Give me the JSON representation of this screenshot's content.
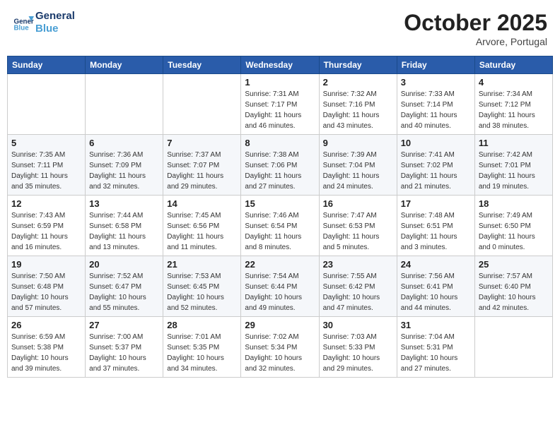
{
  "header": {
    "logo_line1": "General",
    "logo_line2": "Blue",
    "month_title": "October 2025",
    "location": "Arvore, Portugal"
  },
  "days_of_week": [
    "Sunday",
    "Monday",
    "Tuesday",
    "Wednesday",
    "Thursday",
    "Friday",
    "Saturday"
  ],
  "weeks": [
    [
      {
        "day": "",
        "info": ""
      },
      {
        "day": "",
        "info": ""
      },
      {
        "day": "",
        "info": ""
      },
      {
        "day": "1",
        "info": "Sunrise: 7:31 AM\nSunset: 7:17 PM\nDaylight: 11 hours\nand 46 minutes."
      },
      {
        "day": "2",
        "info": "Sunrise: 7:32 AM\nSunset: 7:16 PM\nDaylight: 11 hours\nand 43 minutes."
      },
      {
        "day": "3",
        "info": "Sunrise: 7:33 AM\nSunset: 7:14 PM\nDaylight: 11 hours\nand 40 minutes."
      },
      {
        "day": "4",
        "info": "Sunrise: 7:34 AM\nSunset: 7:12 PM\nDaylight: 11 hours\nand 38 minutes."
      }
    ],
    [
      {
        "day": "5",
        "info": "Sunrise: 7:35 AM\nSunset: 7:11 PM\nDaylight: 11 hours\nand 35 minutes."
      },
      {
        "day": "6",
        "info": "Sunrise: 7:36 AM\nSunset: 7:09 PM\nDaylight: 11 hours\nand 32 minutes."
      },
      {
        "day": "7",
        "info": "Sunrise: 7:37 AM\nSunset: 7:07 PM\nDaylight: 11 hours\nand 29 minutes."
      },
      {
        "day": "8",
        "info": "Sunrise: 7:38 AM\nSunset: 7:06 PM\nDaylight: 11 hours\nand 27 minutes."
      },
      {
        "day": "9",
        "info": "Sunrise: 7:39 AM\nSunset: 7:04 PM\nDaylight: 11 hours\nand 24 minutes."
      },
      {
        "day": "10",
        "info": "Sunrise: 7:41 AM\nSunset: 7:02 PM\nDaylight: 11 hours\nand 21 minutes."
      },
      {
        "day": "11",
        "info": "Sunrise: 7:42 AM\nSunset: 7:01 PM\nDaylight: 11 hours\nand 19 minutes."
      }
    ],
    [
      {
        "day": "12",
        "info": "Sunrise: 7:43 AM\nSunset: 6:59 PM\nDaylight: 11 hours\nand 16 minutes."
      },
      {
        "day": "13",
        "info": "Sunrise: 7:44 AM\nSunset: 6:58 PM\nDaylight: 11 hours\nand 13 minutes."
      },
      {
        "day": "14",
        "info": "Sunrise: 7:45 AM\nSunset: 6:56 PM\nDaylight: 11 hours\nand 11 minutes."
      },
      {
        "day": "15",
        "info": "Sunrise: 7:46 AM\nSunset: 6:54 PM\nDaylight: 11 hours\nand 8 minutes."
      },
      {
        "day": "16",
        "info": "Sunrise: 7:47 AM\nSunset: 6:53 PM\nDaylight: 11 hours\nand 5 minutes."
      },
      {
        "day": "17",
        "info": "Sunrise: 7:48 AM\nSunset: 6:51 PM\nDaylight: 11 hours\nand 3 minutes."
      },
      {
        "day": "18",
        "info": "Sunrise: 7:49 AM\nSunset: 6:50 PM\nDaylight: 11 hours\nand 0 minutes."
      }
    ],
    [
      {
        "day": "19",
        "info": "Sunrise: 7:50 AM\nSunset: 6:48 PM\nDaylight: 10 hours\nand 57 minutes."
      },
      {
        "day": "20",
        "info": "Sunrise: 7:52 AM\nSunset: 6:47 PM\nDaylight: 10 hours\nand 55 minutes."
      },
      {
        "day": "21",
        "info": "Sunrise: 7:53 AM\nSunset: 6:45 PM\nDaylight: 10 hours\nand 52 minutes."
      },
      {
        "day": "22",
        "info": "Sunrise: 7:54 AM\nSunset: 6:44 PM\nDaylight: 10 hours\nand 49 minutes."
      },
      {
        "day": "23",
        "info": "Sunrise: 7:55 AM\nSunset: 6:42 PM\nDaylight: 10 hours\nand 47 minutes."
      },
      {
        "day": "24",
        "info": "Sunrise: 7:56 AM\nSunset: 6:41 PM\nDaylight: 10 hours\nand 44 minutes."
      },
      {
        "day": "25",
        "info": "Sunrise: 7:57 AM\nSunset: 6:40 PM\nDaylight: 10 hours\nand 42 minutes."
      }
    ],
    [
      {
        "day": "26",
        "info": "Sunrise: 6:59 AM\nSunset: 5:38 PM\nDaylight: 10 hours\nand 39 minutes."
      },
      {
        "day": "27",
        "info": "Sunrise: 7:00 AM\nSunset: 5:37 PM\nDaylight: 10 hours\nand 37 minutes."
      },
      {
        "day": "28",
        "info": "Sunrise: 7:01 AM\nSunset: 5:35 PM\nDaylight: 10 hours\nand 34 minutes."
      },
      {
        "day": "29",
        "info": "Sunrise: 7:02 AM\nSunset: 5:34 PM\nDaylight: 10 hours\nand 32 minutes."
      },
      {
        "day": "30",
        "info": "Sunrise: 7:03 AM\nSunset: 5:33 PM\nDaylight: 10 hours\nand 29 minutes."
      },
      {
        "day": "31",
        "info": "Sunrise: 7:04 AM\nSunset: 5:31 PM\nDaylight: 10 hours\nand 27 minutes."
      },
      {
        "day": "",
        "info": ""
      }
    ]
  ]
}
